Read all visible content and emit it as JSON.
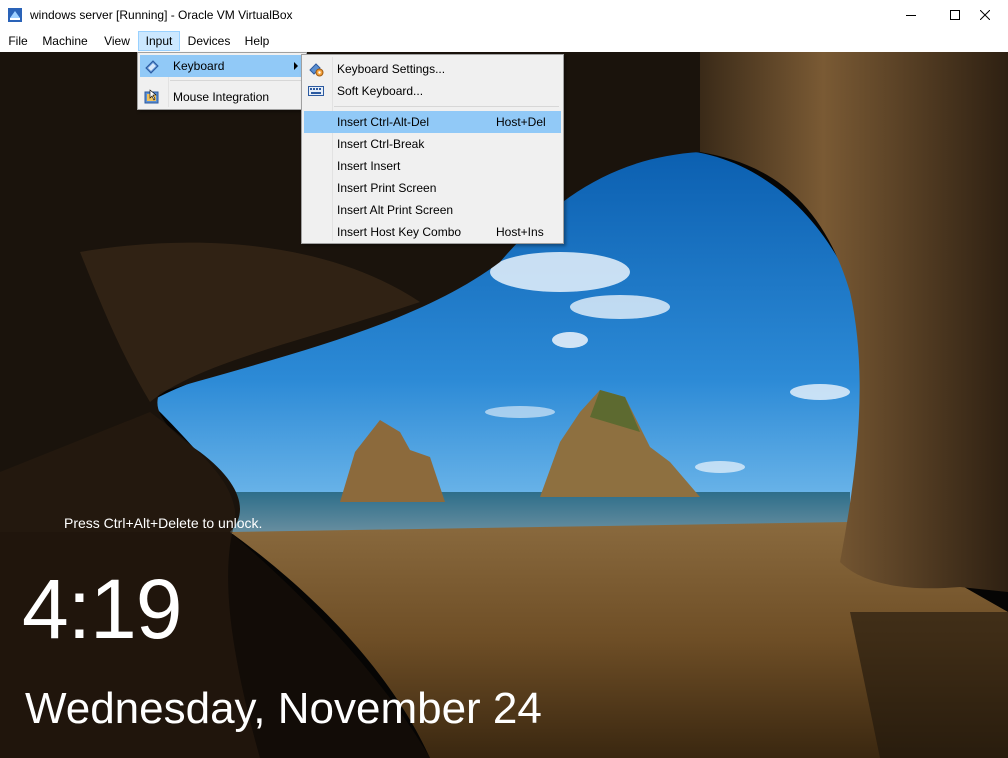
{
  "window": {
    "title": "windows server [Running] - Oracle VM VirtualBox"
  },
  "menubar": {
    "items": [
      {
        "label": "File"
      },
      {
        "label": "Machine"
      },
      {
        "label": "View"
      },
      {
        "label": "Input"
      },
      {
        "label": "Devices"
      },
      {
        "label": "Help"
      }
    ]
  },
  "input_menu": {
    "items": [
      {
        "label": "Keyboard",
        "icon": "keyboard-icon"
      },
      {
        "label": "Mouse Integration",
        "icon": "mouse-integration-icon"
      }
    ]
  },
  "keyboard_menu": {
    "items": [
      {
        "label": "Keyboard Settings...",
        "shortcut": "",
        "icon": "keyboard-settings-icon"
      },
      {
        "label": "Soft Keyboard...",
        "shortcut": "",
        "icon": "soft-keyboard-icon"
      },
      {
        "label": "Insert Ctrl-Alt-Del",
        "shortcut": "Host+Del"
      },
      {
        "label": "Insert Ctrl-Break",
        "shortcut": ""
      },
      {
        "label": "Insert Insert",
        "shortcut": ""
      },
      {
        "label": "Insert Print Screen",
        "shortcut": ""
      },
      {
        "label": "Insert Alt Print Screen",
        "shortcut": ""
      },
      {
        "label": "Insert Host Key Combo",
        "shortcut": "Host+Ins"
      }
    ]
  },
  "lockscreen": {
    "hint": "Press Ctrl+Alt+Delete to unlock.",
    "time": "4:19",
    "date": "Wednesday, November 24"
  },
  "colors": {
    "menu_highlight": "#91c9f7",
    "menubar_active": "#cce8ff",
    "menu_background": "#f0f0f0"
  }
}
